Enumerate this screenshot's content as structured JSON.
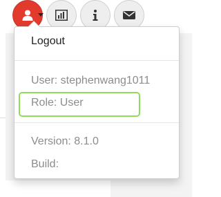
{
  "toolbar": {
    "buttons": [
      {
        "name": "user-menu-button",
        "icon": "user-icon"
      },
      {
        "name": "stats-button",
        "icon": "bar-chart-icon"
      },
      {
        "name": "info-button",
        "icon": "info-icon"
      },
      {
        "name": "mail-button",
        "icon": "envelope-icon"
      }
    ]
  },
  "menu": {
    "logout_label": "Logout",
    "user_text": "User: stephenwang1011",
    "role_text": "Role: User",
    "version_text": "Version: 8.1.0",
    "build_text": "Build:"
  },
  "colors": {
    "user_button": "#e23b2e",
    "highlight": "#8fdc5a"
  }
}
